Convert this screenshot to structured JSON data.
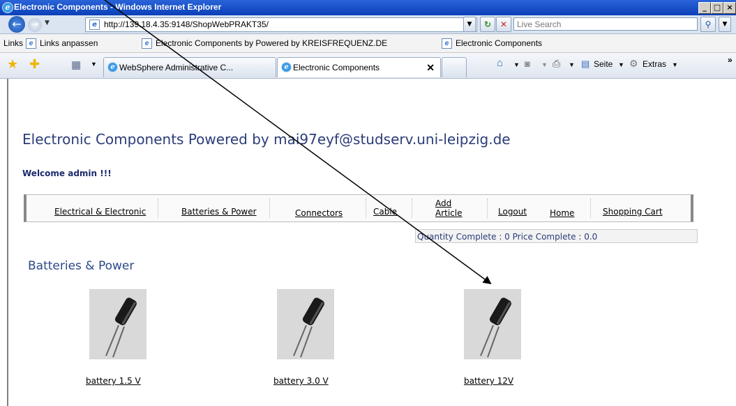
{
  "window": {
    "title": "Electronic Components - Windows Internet Explorer"
  },
  "toolbar": {
    "url": "http://139.18.4.35:9148/ShopWebPRAKT35/",
    "search_placeholder": "Live Search"
  },
  "links_bar": {
    "label": "Links",
    "items": [
      "Links anpassen",
      "Electronic Components by Powered by KREISFREQUENZ.DE",
      "Electronic Components"
    ]
  },
  "tabs": [
    {
      "label": "WebSphere Administrative C..."
    },
    {
      "label": "Electronic Components"
    }
  ],
  "commands": {
    "page": "Seite",
    "tools": "Extras"
  },
  "page": {
    "heading": "Electronic Components Powered by mai97eyf@studserv.uni-leipzig.de",
    "welcome": "Welcome admin !!!",
    "menu": [
      "Electrical & Electronic",
      "Batteries & Power",
      "Connectors",
      "Cable",
      "Add Article",
      "Logout",
      "Home",
      "Shopping Cart"
    ],
    "totals": "Quantity Complete : 0   Price Complete :    0.0",
    "section_title": "Batteries & Power",
    "products": [
      {
        "name": "battery 1.5 V"
      },
      {
        "name": "battery 3.0 V"
      },
      {
        "name": "battery 12V"
      }
    ]
  },
  "icon_names": [
    "ie-logo-icon",
    "back-arrow-icon",
    "forward-arrow-icon",
    "refresh-icon",
    "stop-icon",
    "search-icon",
    "favorites-star-icon",
    "add-favorites-icon",
    "home-icon",
    "feeds-icon",
    "print-icon",
    "page-icon",
    "tools-gear-icon",
    "tab-close-icon"
  ]
}
